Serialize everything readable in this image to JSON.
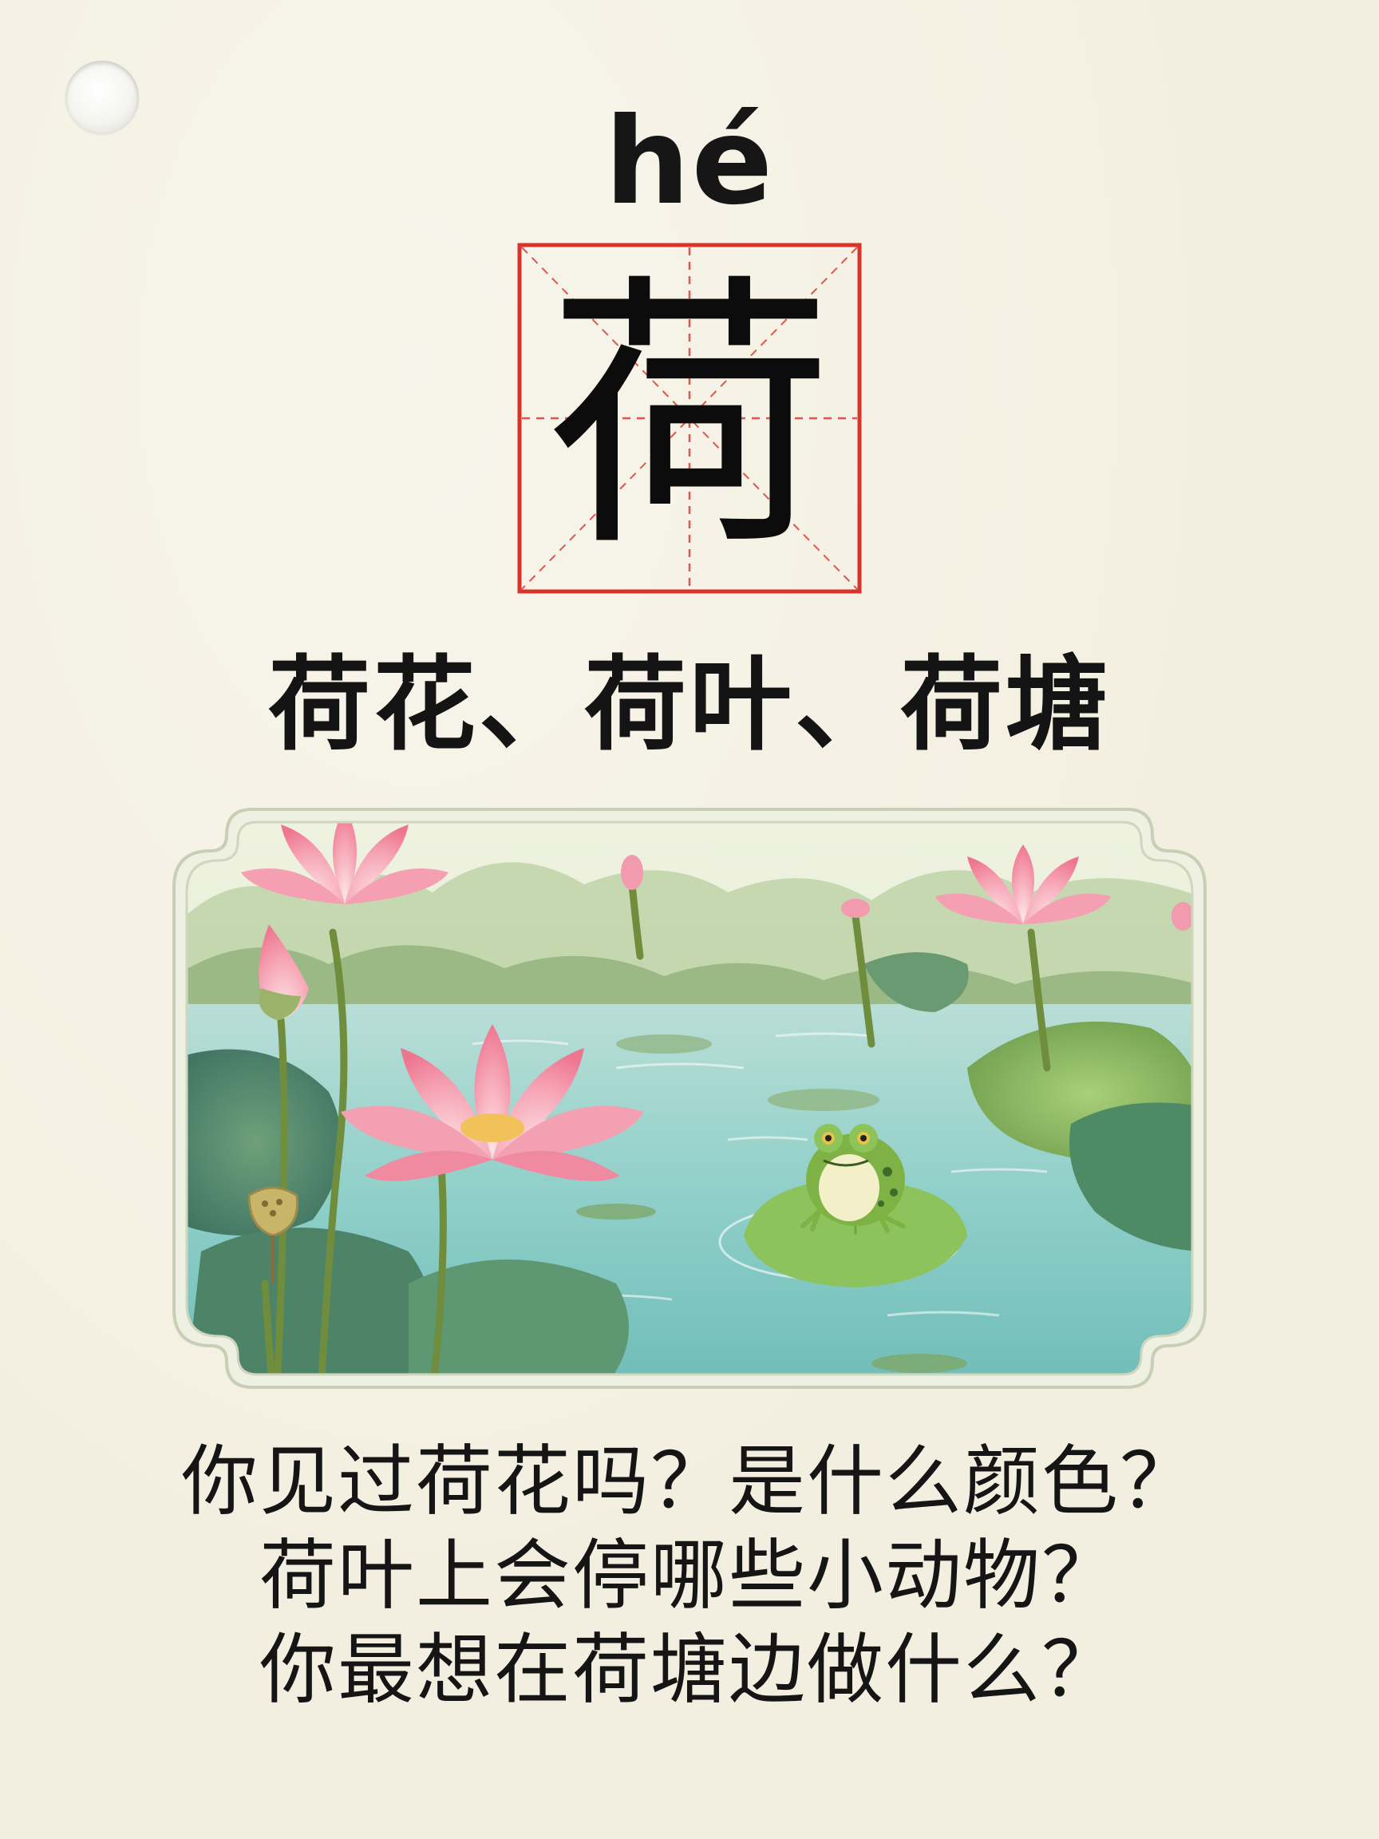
{
  "card": {
    "pinyin": "hé",
    "character": "荷",
    "words": "荷花、荷叶、荷塘",
    "questions": [
      "你见过荷花吗？是什么颜色？",
      "荷叶上会停哪些小动物？",
      "你最想在荷塘边做什么？"
    ]
  },
  "illustration": {
    "subject": "lotus pond with pink lotus flowers, lotus leaves and a green frog sitting on a lily pad",
    "icons": [
      "punch-hole-icon",
      "lotus-flower-icon",
      "lotus-bud-icon",
      "lotus-leaf-icon",
      "lotus-seedpod-icon",
      "frog-icon"
    ]
  },
  "colors": {
    "background": "#f3efe0",
    "grid_red": "#d9342b",
    "text": "#141414",
    "lotus_pink": "#f28aa0",
    "water": "#8fcfc9",
    "leaf_green": "#7fae5a",
    "frame": "#d9dcc8"
  }
}
